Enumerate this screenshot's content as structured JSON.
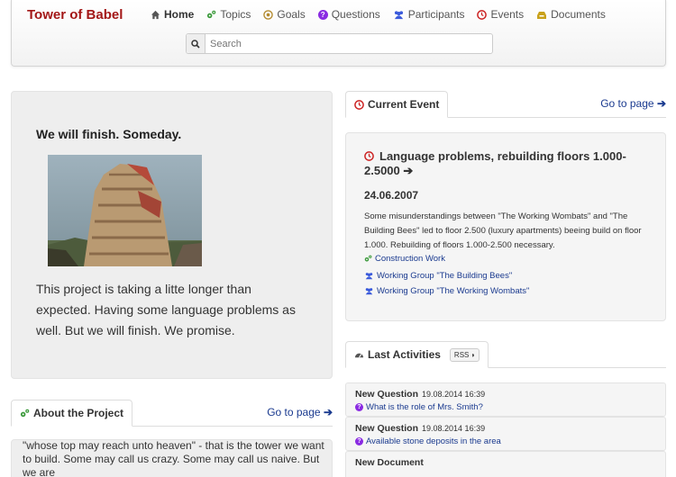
{
  "navbar": {
    "brand": "Tower of Babel",
    "items": [
      {
        "label": "Home",
        "icon": "home-icon",
        "color": "#555555"
      },
      {
        "label": "Topics",
        "icon": "cogs-icon",
        "color": "#3c9a3c"
      },
      {
        "label": "Goals",
        "icon": "target-icon",
        "color": "#b38a2e"
      },
      {
        "label": "Questions",
        "icon": "question-icon",
        "color": "#8a2be2"
      },
      {
        "label": "Participants",
        "icon": "users-icon",
        "color": "#3b5bdb"
      },
      {
        "label": "Events",
        "icon": "clock-icon",
        "color": "#cc2222"
      },
      {
        "label": "Documents",
        "icon": "inbox-icon",
        "color": "#c9a11a"
      }
    ],
    "search_placeholder": "Search"
  },
  "hero": {
    "title": "We will finish. Someday.",
    "text": "This project is taking a litte longer than expected. Having some language problems as well. But we will finish. We promise."
  },
  "about": {
    "tab_label": "About the Project",
    "goto_label": "Go to page",
    "text": "\"whose top may reach unto heaven\" - that is the tower we want to build. Some may call us crazy. Some may call us naive. But we are"
  },
  "current_event": {
    "tab_label": "Current Event",
    "goto_label": "Go to page",
    "title": "Language problems, rebuilding floors 1.000-2.5000",
    "date": "24.06.2007",
    "description": "Some misunderstandings between \"The Working Wombats\" and \"The Building Bees\" led to floor 2.500 (luxury apartments) beeing build on floor 1.000. Rebuilding of floors 1.000-2.500 necessary.",
    "links": [
      {
        "label": "Construction Work",
        "icon": "cogs-icon"
      },
      {
        "label": "Working Group \"The Building Bees\"",
        "icon": "users-icon"
      },
      {
        "label": "Working Group \"The Working Wombats\"",
        "icon": "users-icon"
      }
    ]
  },
  "activities": {
    "tab_label": "Last Activities",
    "rss_label": "RSS",
    "items": [
      {
        "type": "New Question",
        "time": "19.08.2014 16:39",
        "link": "What is the role of Mrs. Smith?"
      },
      {
        "type": "New Question",
        "time": "19.08.2014 16:39",
        "link": "Available stone deposits in the area"
      },
      {
        "type": "New Document",
        "time": "",
        "link": ""
      }
    ]
  },
  "colors": {
    "brand": "#a31717",
    "link": "#1a3a8f",
    "accent_green": "#3c9a3c"
  }
}
